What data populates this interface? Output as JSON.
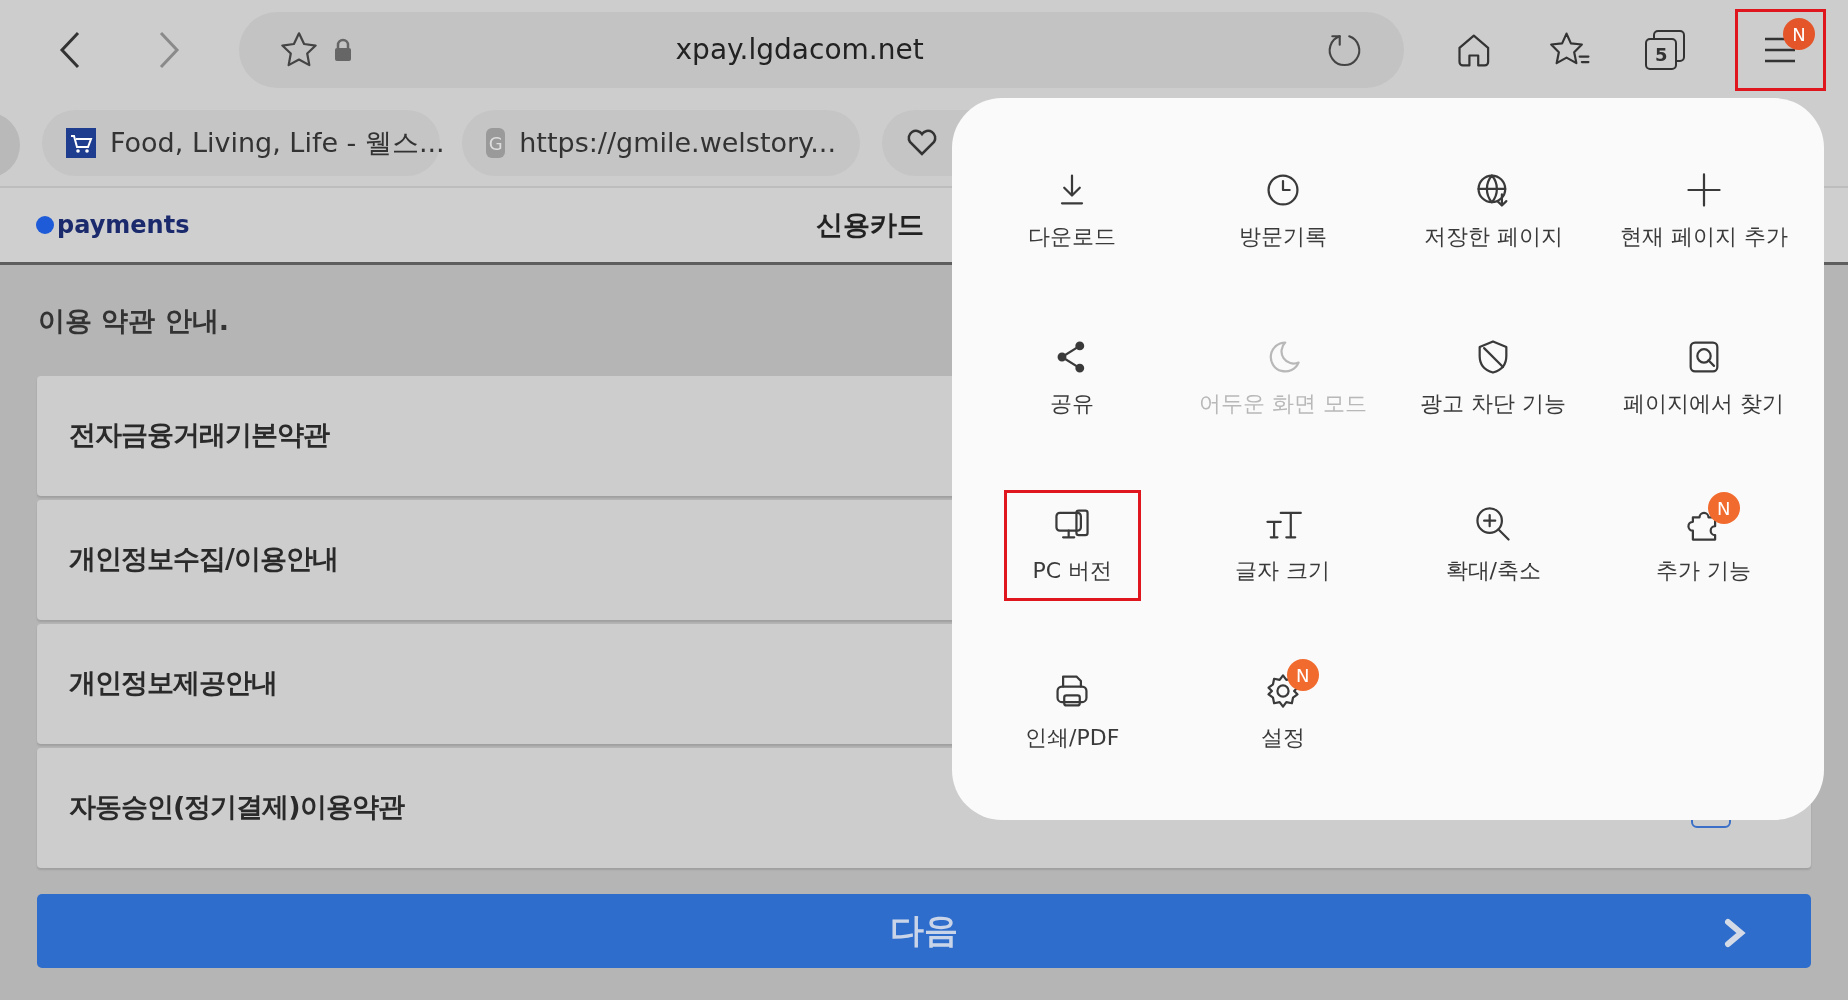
{
  "toolbar": {
    "back_disabled": false,
    "forward_disabled": true,
    "url": "xpay.lgdacom.net",
    "tab_count": "5",
    "menu_badge": "N",
    "menu_highlighted": true
  },
  "tabs": [
    {
      "kind": "cart",
      "title": "Food, Living, Life - 웰스..."
    },
    {
      "kind": "letter",
      "title": "https://gmile.welstory...",
      "favicon_letter": "G"
    },
    {
      "kind": "heart"
    }
  ],
  "page": {
    "logo": "payments",
    "title": "신용카드",
    "section_title": "이용 약관 안내.",
    "terms": [
      {
        "label": "전자금융거래기본약관"
      },
      {
        "label": "개인정보수집/이용안내"
      },
      {
        "label": "개인정보제공안내"
      },
      {
        "label": "자동승인(정기결제)이용약관",
        "checked": false
      }
    ],
    "next_button": "다음"
  },
  "menu": {
    "items": [
      {
        "label": "다운로드",
        "disabled": false,
        "highlighted": false
      },
      {
        "label": "방문기록",
        "disabled": false,
        "highlighted": false
      },
      {
        "label": "저장한 페이지",
        "disabled": false,
        "highlighted": false
      },
      {
        "label": "현재 페이지 추가",
        "disabled": false,
        "highlighted": false
      },
      {
        "label": "공유",
        "disabled": false,
        "highlighted": false
      },
      {
        "label": "어두운 화면 모드",
        "disabled": true,
        "highlighted": false
      },
      {
        "label": "광고 차단 기능",
        "disabled": false,
        "highlighted": false
      },
      {
        "label": "페이지에서 찾기",
        "disabled": false,
        "highlighted": false
      },
      {
        "label": "PC 버전",
        "disabled": false,
        "highlighted": true
      },
      {
        "label": "글자 크기",
        "disabled": false,
        "highlighted": false
      },
      {
        "label": "확대/축소",
        "disabled": false,
        "highlighted": false
      },
      {
        "label": "추가 기능",
        "disabled": false,
        "highlighted": false,
        "badge": "N"
      },
      {
        "label": "인쇄/PDF",
        "disabled": false,
        "highlighted": false
      },
      {
        "label": "설정",
        "disabled": false,
        "highlighted": false,
        "badge": "N"
      }
    ]
  }
}
